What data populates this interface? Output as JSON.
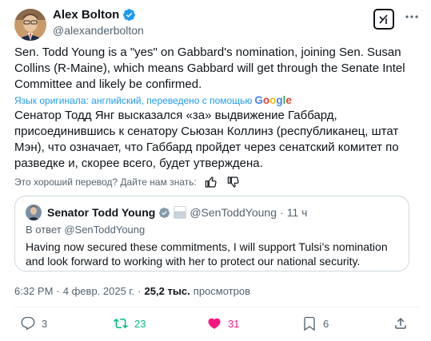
{
  "author": {
    "name": "Alex Bolton",
    "handle": "@alexanderbolton"
  },
  "tweet": {
    "original_text": "Sen. Todd Young is a \"yes\" on Gabbard's nomination, joining Sen. Susan Collins (R-Maine), which means Gabbard will get through the Senate Intel Committee and likely be confirmed.",
    "translation_note": "Язык оригинала: английский, переведено с помощью",
    "translator_brand": "Google",
    "translated_text": "Сенатор Тодд Янг высказался «за» выдвижение Габбард, присоединившись к сенатору Сьюзан Коллинз (республиканец, штат Мэн), что означает, что Габбард пройдет через сенатский комитет по разведке и, скорее всего, будет утверждена.",
    "feedback_prompt": "Это хороший перевод? Дайте нам знать:"
  },
  "quote": {
    "name": "Senator Todd Young",
    "handle": "@SenToddYoung",
    "separator": "·",
    "time": "11 ч",
    "reply_prefix": "В ответ",
    "reply_handle": "@SenToddYoung",
    "text": "Having now secured these commitments, I will support Tulsi’s nomination and look forward to working with her to protect our national security."
  },
  "meta": {
    "time": "6:32 PM",
    "dot": "·",
    "date": "4 февр. 2025 г.",
    "dot2": "·",
    "views_count": "25,2 тыс.",
    "views_label": "просмотров"
  },
  "actions": {
    "replies": "3",
    "reposts": "23",
    "likes": "31",
    "bookmarks": "6"
  },
  "colors": {
    "verified": "#1d9bf0",
    "repost_active": "#00ba7c",
    "like_active": "#f91880",
    "link": "#1d9bf0",
    "muted": "#536471"
  },
  "icons": [
    "verified-badge-icon",
    "grok-icon",
    "more-icon",
    "thumbs-up-icon",
    "thumbs-down-icon",
    "reply-icon",
    "repost-icon",
    "like-icon",
    "bookmark-icon",
    "share-icon"
  ]
}
